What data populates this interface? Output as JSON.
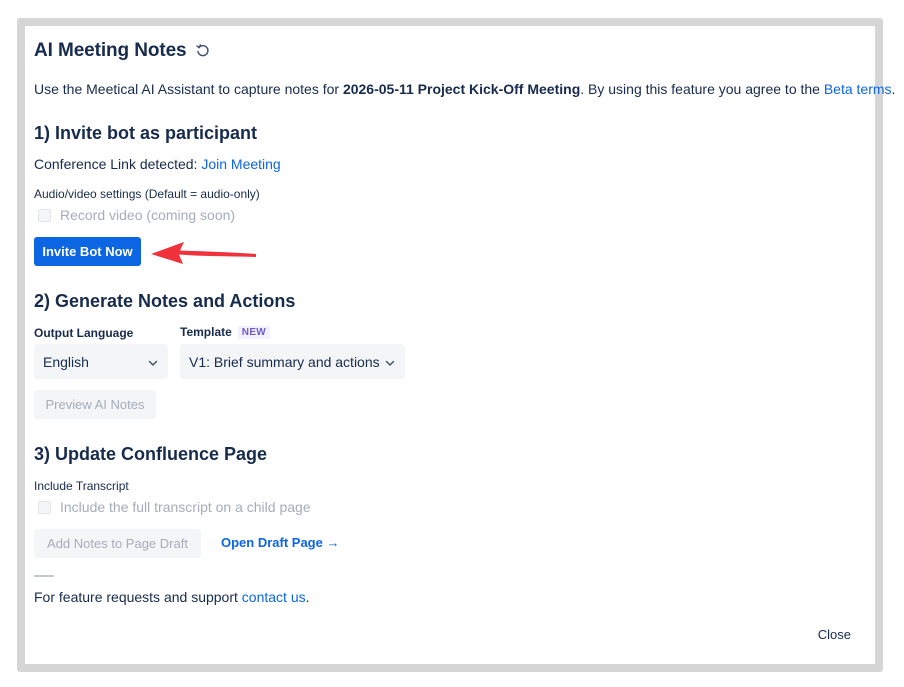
{
  "dialog": {
    "title": "AI Meeting Notes",
    "intro_prefix": "Use the Meetical AI Assistant to capture notes for ",
    "meeting_name": "2026-05-11 Project Kick-Off Meeting",
    "intro_middle": ". By using this feature you agree to the ",
    "beta_terms_link": "Beta terms",
    "intro_suffix": ".",
    "close_label": "Close"
  },
  "section1": {
    "heading": "1) Invite bot as participant",
    "conference_label": "Conference Link detected: ",
    "join_meeting_link": "Join Meeting",
    "av_settings_label": "Audio/video settings (Default = audio-only)",
    "record_video_label": "Record video (coming soon)",
    "record_video_checked": false,
    "invite_button": "Invite Bot Now",
    "arrow_color": "#f0323c"
  },
  "section2": {
    "heading": "2) Generate Notes and Actions",
    "output_language_label": "Output Language",
    "output_language_value": "English",
    "template_label": "Template",
    "template_badge": "NEW",
    "template_value": "V1: Brief summary and actions",
    "preview_button": "Preview AI Notes"
  },
  "section3": {
    "heading": "3) Update Confluence Page",
    "include_transcript_label": "Include Transcript",
    "child_page_checkbox_label": "Include the full transcript on a child page",
    "child_page_checked": false,
    "add_notes_button": "Add Notes to Page Draft",
    "open_draft_link": "Open Draft Page →"
  },
  "footer": {
    "support_prefix": "For feature requests and support ",
    "contact_link": "contact us",
    "support_suffix": "."
  },
  "colors": {
    "primary": "#0c66e4",
    "text": "#172b4d",
    "disabled_text": "#a5adba",
    "badge_text": "#6e5dc6"
  }
}
